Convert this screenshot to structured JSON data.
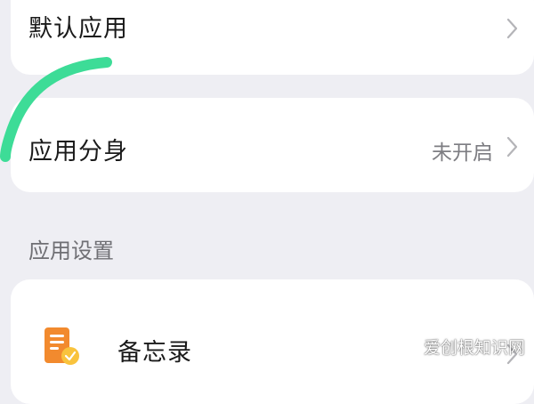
{
  "rows": {
    "default_apps": {
      "label": "默认应用",
      "icon": "chevron-right-icon"
    },
    "app_clone": {
      "label": "应用分身",
      "value": "未开启",
      "icon": "chevron-right-icon"
    }
  },
  "section_header": "应用设置",
  "apps": [
    {
      "label": "备忘录",
      "icon": "notes-app-icon"
    }
  ],
  "watermark": "爱创根知识网",
  "colors": {
    "background": "#eeeef3",
    "card": "#ffffff",
    "highlight_stroke": "#3ddc97",
    "secondary_text": "#7d7d82",
    "notes_icon_orange": "#f28a2e",
    "notes_icon_yellow": "#f9c33d"
  }
}
